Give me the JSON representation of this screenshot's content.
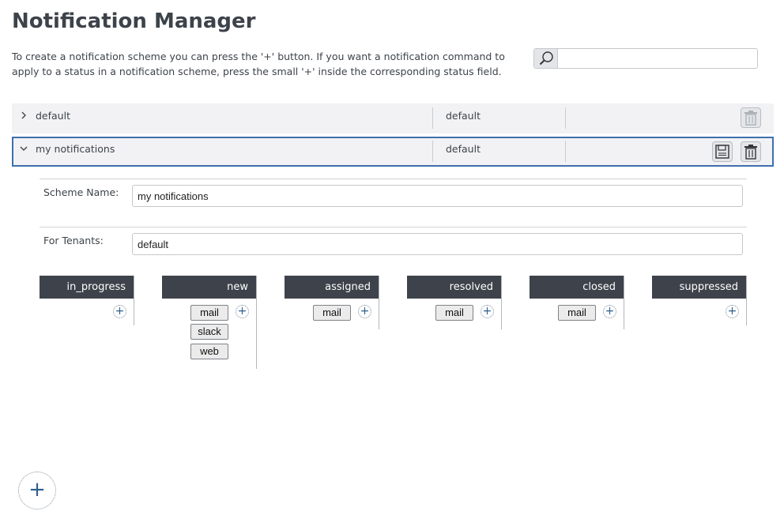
{
  "page": {
    "title": "Notification Manager",
    "intro": "To create a notification scheme you can press the '+' button. If you want a notification command to apply to a status in a notification scheme, press the small '+' inside the corresponding status field."
  },
  "search": {
    "value": "",
    "icon": "search-icon"
  },
  "schemes": [
    {
      "name": "default",
      "tenant": "default",
      "expanded": false
    },
    {
      "name": "my notifications",
      "tenant": "default",
      "expanded": true
    }
  ],
  "detail": {
    "scheme_name_label": "Scheme Name:",
    "scheme_name_value": "my notifications",
    "tenants_label": "For Tenants:",
    "tenants_value": "default"
  },
  "statuses": [
    {
      "name": "in_progress",
      "commands": []
    },
    {
      "name": "new",
      "commands": [
        "mail",
        "slack",
        "web"
      ]
    },
    {
      "name": "assigned",
      "commands": [
        "mail"
      ]
    },
    {
      "name": "resolved",
      "commands": [
        "mail"
      ]
    },
    {
      "name": "closed",
      "commands": [
        "mail"
      ]
    },
    {
      "name": "suppressed",
      "commands": []
    }
  ],
  "actions": {
    "add_symbol": "+"
  },
  "colors": {
    "header_dark": "#3e434b",
    "selected_border": "#3f6fae",
    "row_bg": "#f2f2f4"
  }
}
